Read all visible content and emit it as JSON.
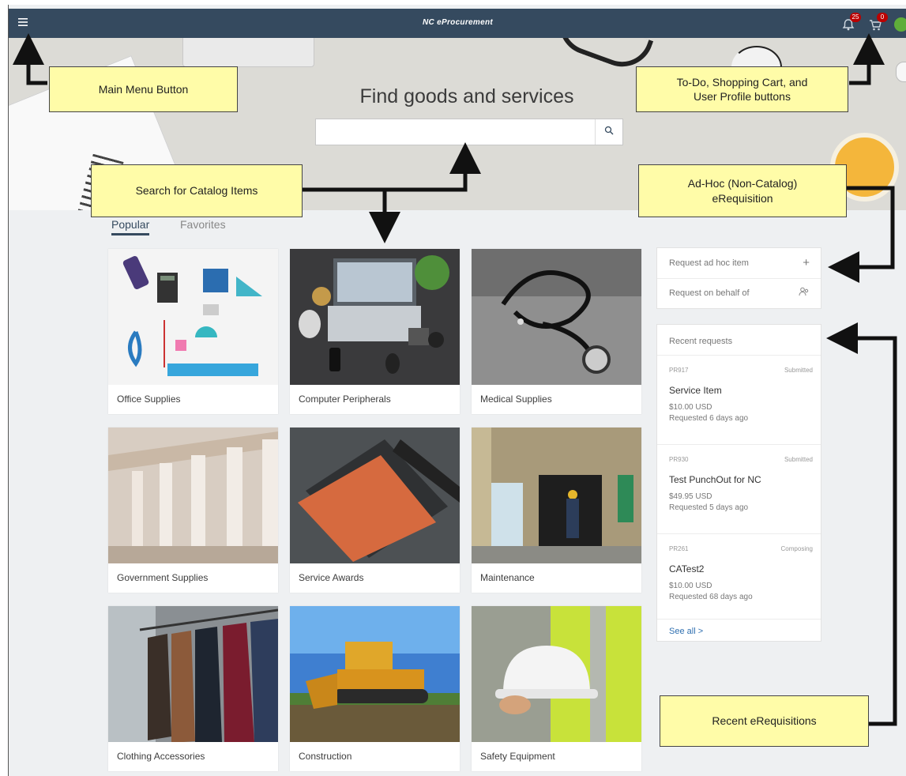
{
  "shell": {
    "title": "NC eProcurement",
    "menu_icon": "hamburger-icon",
    "todo_badge": "25",
    "cart_badge": "0",
    "avatar_initials": ""
  },
  "hero": {
    "heading": "Find goods and services",
    "search_value": "",
    "search_icon": "search-icon"
  },
  "tabs": [
    {
      "label": "Popular",
      "active": true
    },
    {
      "label": "Favorites",
      "active": false
    }
  ],
  "categories": [
    {
      "label": "Office Supplies"
    },
    {
      "label": "Computer Peripherals"
    },
    {
      "label": "Medical Supplies"
    },
    {
      "label": "Government Supplies"
    },
    {
      "label": "Service Awards"
    },
    {
      "label": "Maintenance"
    },
    {
      "label": "Clothing Accessories"
    },
    {
      "label": "Construction"
    },
    {
      "label": "Safety Equipment"
    }
  ],
  "actions": {
    "adhoc_label": "Request ad hoc item",
    "adhoc_icon": "plus-icon",
    "behalf_label": "Request on behalf of",
    "behalf_icon": "people-icon"
  },
  "recent": {
    "header": "Recent requests",
    "items": [
      {
        "id": "PR917",
        "status": "Submitted",
        "name": "Service Item",
        "amount": "$10.00 USD",
        "requested": "Requested 6 days ago"
      },
      {
        "id": "PR930",
        "status": "Submitted",
        "name": "Test PunchOut for NC",
        "amount": "$49.95 USD",
        "requested": "Requested 5 days ago"
      },
      {
        "id": "PR261",
        "status": "Composing",
        "name": "CATest2",
        "amount": "$10.00 USD",
        "requested": "Requested 68 days ago"
      }
    ],
    "see_all": "See all"
  },
  "callouts": {
    "main_menu": "Main Menu Button",
    "header_buttons_line1": "To-Do, Shopping Cart, and",
    "header_buttons_line2": "User Profile buttons",
    "search": "Search for Catalog Items",
    "adhoc_line1": "Ad-Hoc (Non-Catalog)",
    "adhoc_line2": "eRequisition",
    "recent": "Recent eRequisitions"
  },
  "colors": {
    "shell": "#354a5f",
    "callout_fill": "#fffca8",
    "badge": "#bb0000",
    "avatar": "#5fae3a"
  }
}
